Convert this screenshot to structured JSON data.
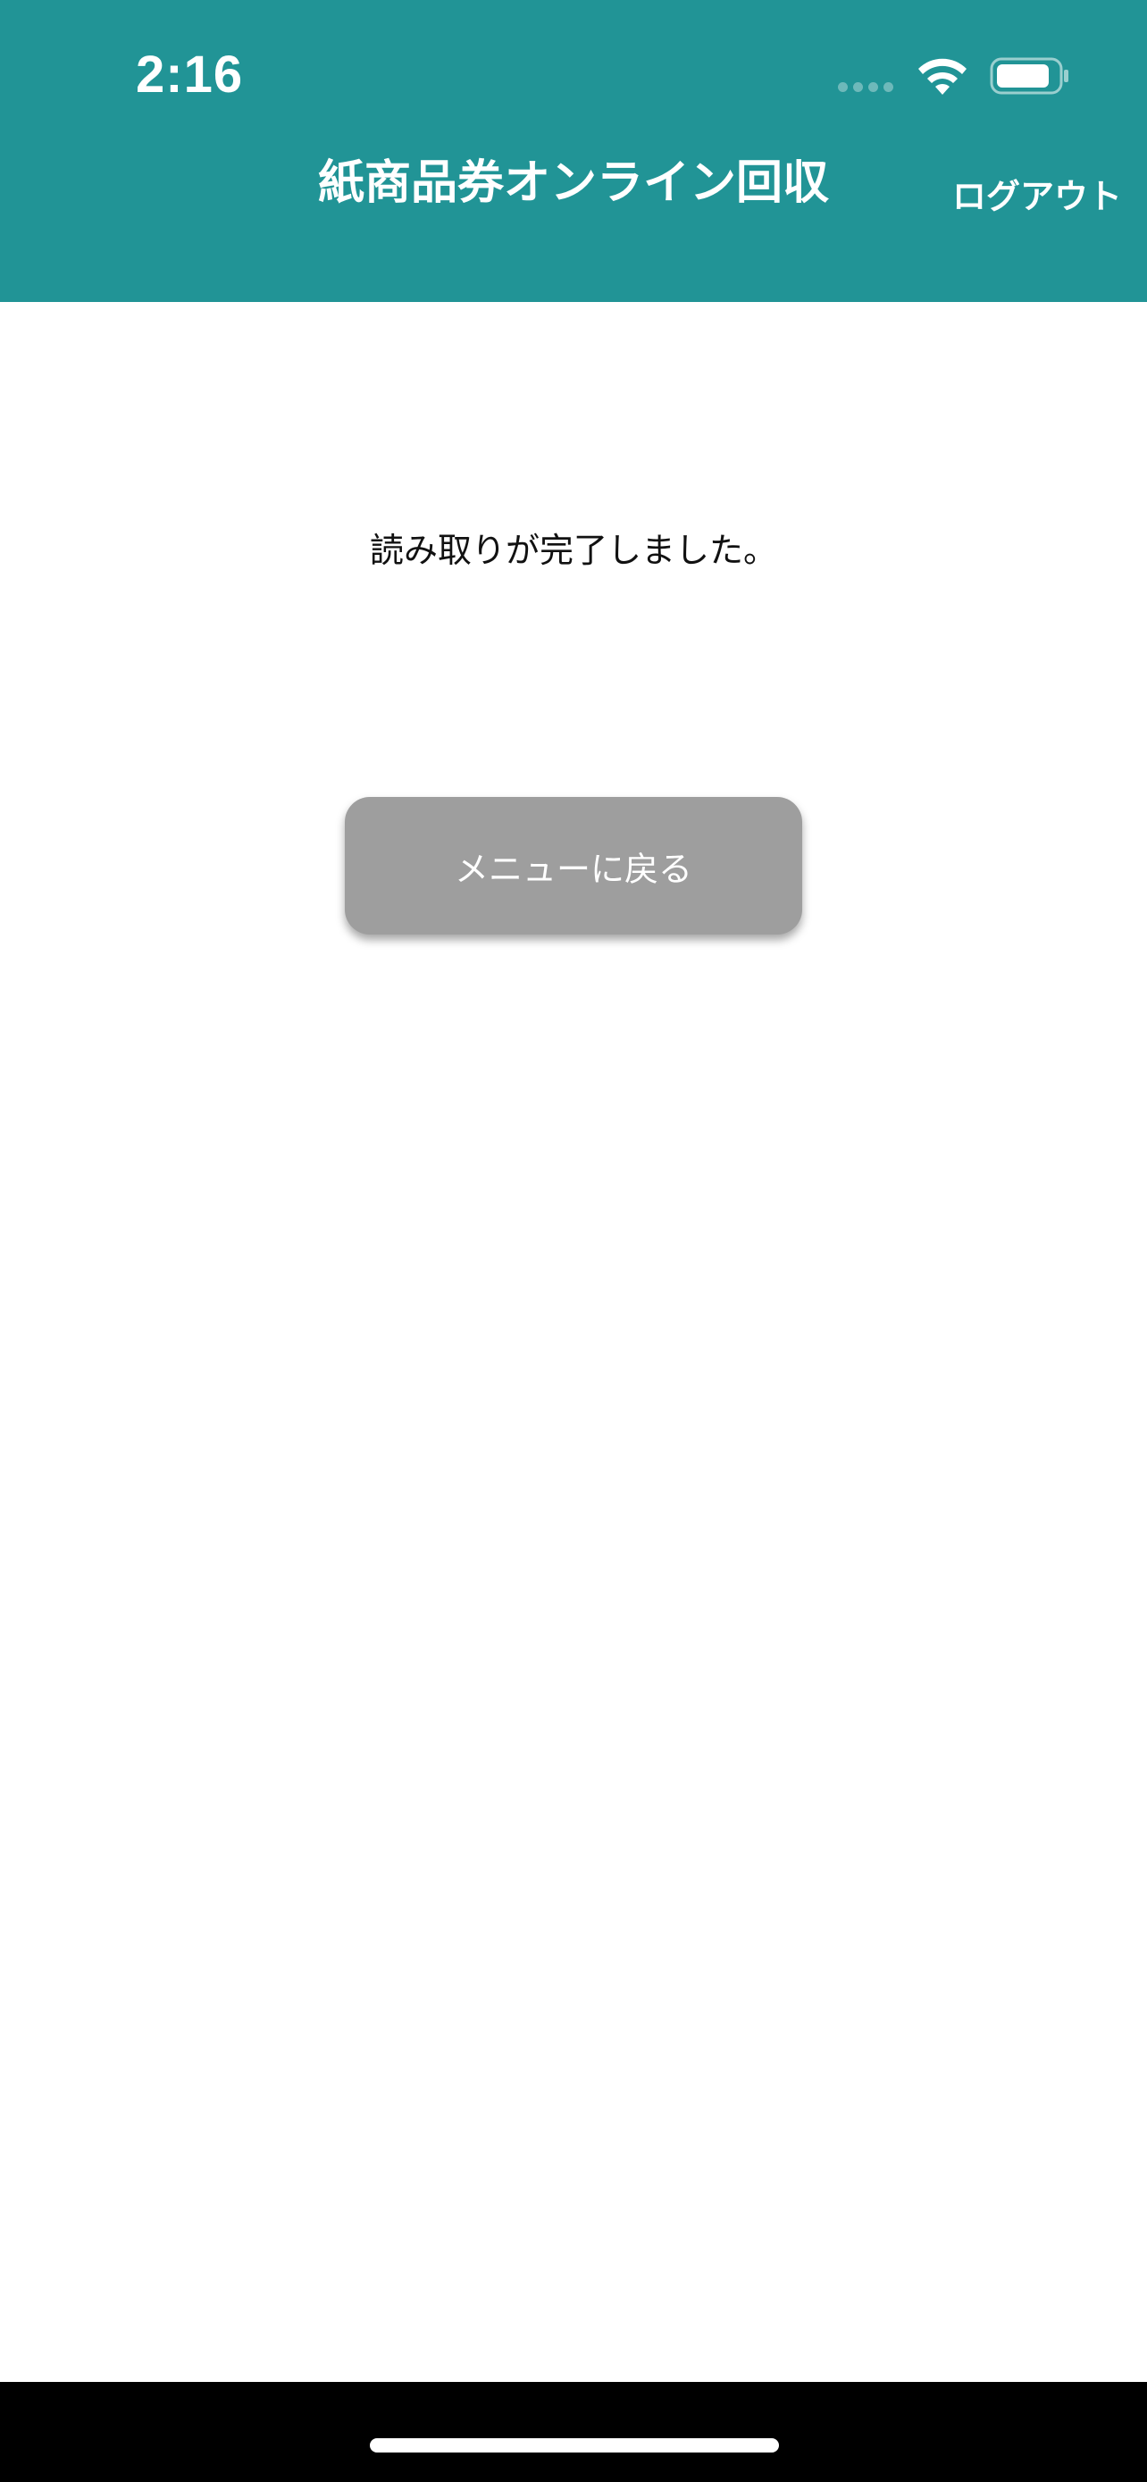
{
  "status_bar": {
    "time": "2:16"
  },
  "nav": {
    "title": "紙商品券オンライン回収",
    "logout_label": "ログアウト"
  },
  "main": {
    "message": "読み取りが完了しました。",
    "menu_button_label": "メニューに戻る"
  },
  "colors": {
    "header": "#219496",
    "button": "#9e9e9e",
    "background": "#ffffff"
  },
  "icons": {
    "status": [
      "signal-icon",
      "wifi-icon",
      "battery-icon"
    ]
  }
}
